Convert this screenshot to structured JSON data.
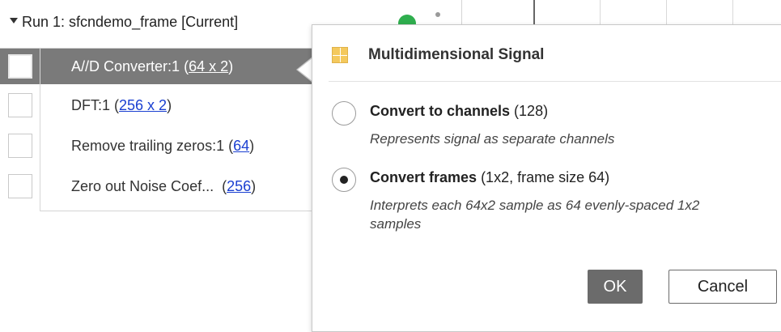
{
  "run": {
    "title": "Run 1: sfcndemo_frame [Current]"
  },
  "signals": [
    {
      "name": "A//D Converter:1",
      "dims": "64 x 2",
      "selected": true
    },
    {
      "name": "DFT:1",
      "dims": "256 x 2",
      "selected": false
    },
    {
      "name": "Remove trailing zeros:1",
      "dims": "64",
      "selected": false
    },
    {
      "name": "Zero out Noise Coef...",
      "dims": "256",
      "selected": false
    }
  ],
  "popup": {
    "title": "Multidimensional Signal",
    "options": [
      {
        "label": "Convert to channels",
        "detail": "(128)",
        "description": "Represents signal as separate channels",
        "selected": false
      },
      {
        "label": "Convert frames",
        "detail": "(1x2, frame size 64)",
        "description": "Interprets each 64x2 sample as 64 evenly-spaced 1x2 samples",
        "selected": true
      }
    ],
    "ok_label": "OK",
    "cancel_label": "Cancel"
  },
  "colors": {
    "selected_row": "#7a7a7a",
    "status_green": "#2fae4e",
    "link_blue": "#1a3fd1",
    "ok_button": "#6b6b6b"
  },
  "icons": {
    "run_caret": "caret-down-icon",
    "run_status": "status-dot-icon",
    "popup": "grid-table-icon"
  }
}
